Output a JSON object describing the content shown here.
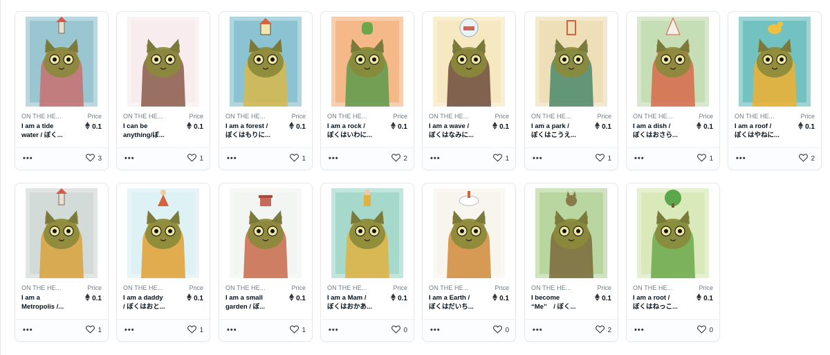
{
  "price_label": "Price",
  "currency_icon": "ethereum-icon",
  "more_label": "•••",
  "cards": [
    {
      "collection": "ON THE HE...",
      "title_line1": "I am a tide",
      "title_line2": "water / ぼく...",
      "price": "0.1",
      "likes": "3",
      "bg": "#7fb8c4",
      "accent": "#c86f6f",
      "prop": "tower"
    },
    {
      "collection": "ON THE HE...",
      "title_line1": "I can be",
      "title_line2": "anything/ぼ...",
      "price": "0.1",
      "likes": "1",
      "bg": "#f7e8ea",
      "accent": "#8a5a4a",
      "prop": "none"
    },
    {
      "collection": "ON THE HE...",
      "title_line1": "I am a forest /",
      "title_line2": "ぼくはもりに...",
      "price": "0.1",
      "likes": "1",
      "bg": "#6fb5c6",
      "accent": "#d9b94a",
      "prop": "house"
    },
    {
      "collection": "ON THE HE...",
      "title_line1": "I am a rock /",
      "title_line2": "ぼくはいわに...",
      "price": "0.1",
      "likes": "2",
      "bg": "#f2a56a",
      "accent": "#5a9a4a",
      "prop": "rock"
    },
    {
      "collection": "ON THE HE...",
      "title_line1": "I am a wave /",
      "title_line2": "ぼくはなみに...",
      "price": "0.1",
      "likes": "1",
      "bg": "#f4e3b0",
      "accent": "#6b4a3a",
      "prop": "ship"
    },
    {
      "collection": "ON THE HE...",
      "title_line1": "I am a park /",
      "title_line2": "ぼくはこうえ...",
      "price": "0.1",
      "likes": "1",
      "bg": "#e9d7a8",
      "accent": "#4a8a6a",
      "prop": "gate"
    },
    {
      "collection": "ON THE HE...",
      "title_line1": "I am a dish /",
      "title_line2": "ぼくはおさら...",
      "price": "0.1",
      "likes": "1",
      "bg": "#b8d6a4",
      "accent": "#d86a4a",
      "prop": "cake"
    },
    {
      "collection": "ON THE HE...",
      "title_line1": "I am a roof /",
      "title_line2": "ぼくはやねに...",
      "price": "0.1",
      "likes": "2",
      "bg": "#4fb3b0",
      "accent": "#f0b030",
      "prop": "bird"
    },
    {
      "collection": "ON THE HE...",
      "title_line1": "I am a",
      "title_line2": "Metropolis /...",
      "price": "0.1",
      "likes": "1",
      "bg": "#c9d2d0",
      "accent": "#d8a23a",
      "prop": "tower"
    },
    {
      "collection": "ON THE HE...",
      "title_line1": "I am a daddy",
      "title_line2": "/ ぼくはおと...",
      "price": "0.1",
      "likes": "1",
      "bg": "#d6ecf2",
      "accent": "#e0a030",
      "prop": "girl"
    },
    {
      "collection": "ON THE HE...",
      "title_line1": "I am a small",
      "title_line2": "garden / ぼ...",
      "price": "0.1",
      "likes": "1",
      "bg": "#eef2ee",
      "accent": "#c86a4a",
      "prop": "pot"
    },
    {
      "collection": "ON THE HE...",
      "title_line1": "I am a Mam /",
      "title_line2": "ぼくはおかあ...",
      "price": "0.1",
      "likes": "0",
      "bg": "#8fd0c0",
      "accent": "#e0b040",
      "prop": "kid"
    },
    {
      "collection": "ON THE HE...",
      "title_line1": "I am a Earth /",
      "title_line2": "ぼくはだいち...",
      "price": "0.1",
      "likes": "0",
      "bg": "#f5f2ea",
      "accent": "#d08a3a",
      "prop": "cloud"
    },
    {
      "collection": "ON THE HE...",
      "title_line1": "I become",
      "title_line2": "“Me”　/ ぼく...",
      "price": "0.1",
      "likes": "2",
      "bg": "#a8cc88",
      "accent": "#7a6a3a",
      "prop": "cat"
    },
    {
      "collection": "ON THE HE...",
      "title_line1": "I am a root /",
      "title_line2": "ぼくはねっこ...",
      "price": "0.1",
      "likes": "0",
      "bg": "#cfe3a8",
      "accent": "#6aa84a",
      "prop": "tree"
    }
  ]
}
